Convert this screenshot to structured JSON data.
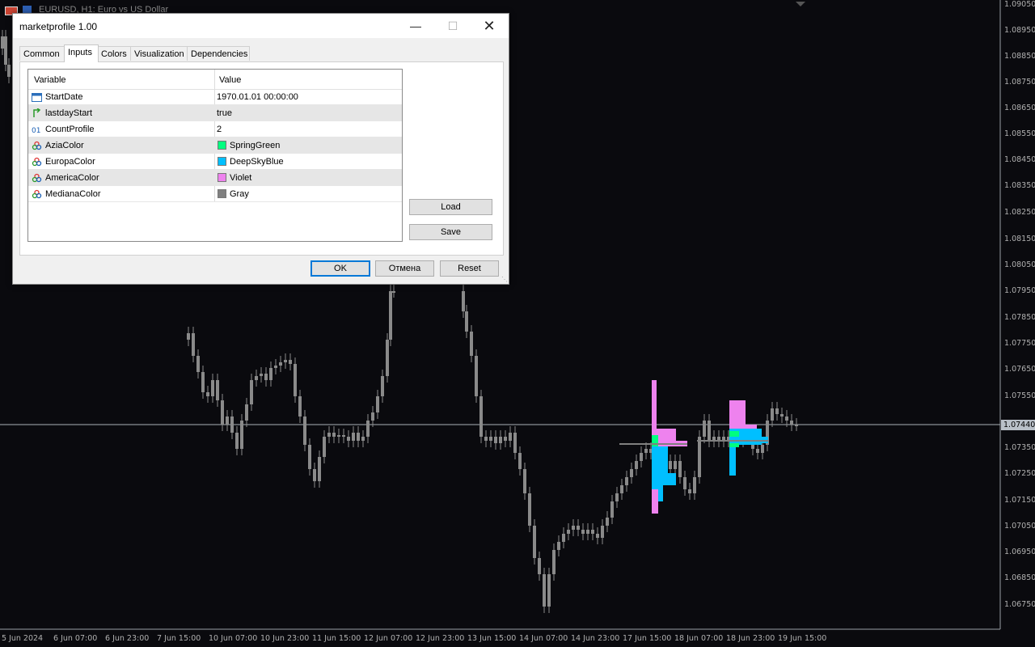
{
  "window": {
    "title": "EURUSD, H1: Euro vs US Dollar"
  },
  "chart": {
    "price_labels": [
      "1.09050",
      "1.08950",
      "1.08850",
      "1.08750",
      "1.08650",
      "1.08550",
      "1.08450",
      "1.08350",
      "1.08250",
      "1.08150",
      "1.08050",
      "1.07950",
      "1.07850",
      "1.07750",
      "1.07650",
      "1.07550",
      "1.07350",
      "1.07250",
      "1.07150",
      "1.07050",
      "1.06950",
      "1.06850",
      "1.06750"
    ],
    "current_price": "1.07440",
    "time_labels": [
      "5 Jun 2024",
      "6 Jun 07:00",
      "6 Jun 23:00",
      "7 Jun 15:00",
      "10 Jun 07:00",
      "10 Jun 23:00",
      "11 Jun 15:00",
      "12 Jun 07:00",
      "12 Jun 23:00",
      "13 Jun 15:00",
      "14 Jun 07:00",
      "14 Jun 23:00",
      "17 Jun 15:00",
      "18 Jun 07:00",
      "18 Jun 23:00",
      "19 Jun 15:00"
    ],
    "colors": {
      "candles": "#8a8a8a",
      "azia": "#00ff7f",
      "europa": "#00bfff",
      "america": "#ee82ee",
      "mediana": "#808080",
      "bg": "#0a0a0e"
    }
  },
  "dialog": {
    "title": "marketprofile 1.00",
    "tabs": [
      "Common",
      "Inputs",
      "Colors",
      "Visualization",
      "Dependencies"
    ],
    "active_tab": "Inputs",
    "columns": {
      "variable": "Variable",
      "value": "Value"
    },
    "params": [
      {
        "icon": "calendar-icon",
        "name": "StartDate",
        "value": "1970.01.01 00:00:00"
      },
      {
        "icon": "bool-icon",
        "name": "lastdayStart",
        "value": "true"
      },
      {
        "icon": "int-icon",
        "name": "CountProfile",
        "value": "2"
      },
      {
        "icon": "color-icon",
        "name": "AziaColor",
        "value": "SpringGreen",
        "swatch": "#00ff7f"
      },
      {
        "icon": "color-icon",
        "name": "EuropaColor",
        "value": "DeepSkyBlue",
        "swatch": "#00bfff"
      },
      {
        "icon": "color-icon",
        "name": "AmericaColor",
        "value": "Violet",
        "swatch": "#ee82ee"
      },
      {
        "icon": "color-icon",
        "name": "MedianaColor",
        "value": "Gray",
        "swatch": "#808080"
      }
    ],
    "buttons": {
      "load": "Load",
      "save": "Save",
      "ok": "OK",
      "cancel": "Отмена",
      "reset": "Reset"
    }
  }
}
